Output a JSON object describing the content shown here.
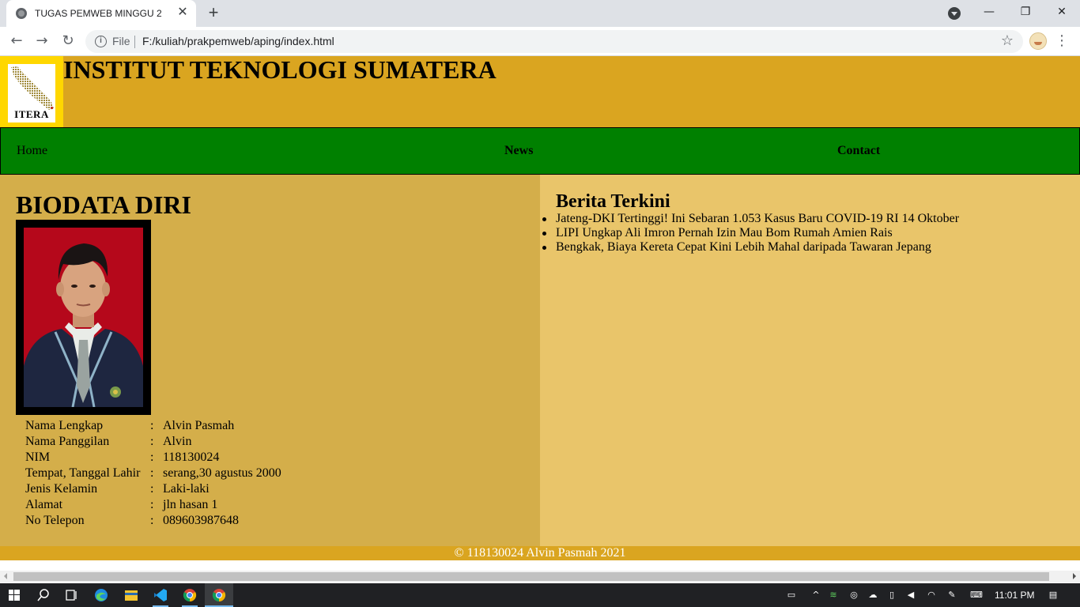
{
  "browser": {
    "tab_title": "TUGAS PEMWEB MINGGU 2",
    "tab_close": "✕",
    "new_tab": "+",
    "scheme_label": "File",
    "url": "F:/kuliah/prakpemweb/aping/index.html",
    "window_controls": {
      "minimize": "—",
      "restore": "❐",
      "close": "✕"
    },
    "nav": {
      "back": "←",
      "forward": "→",
      "reload": "↻"
    },
    "info": "i",
    "star": "☆",
    "menu": "⋮"
  },
  "site": {
    "logo_text": "ITERA",
    "title": "INSTITUT TEKNOLOGI SUMATERA",
    "nav": [
      "Home",
      "News",
      "Contact"
    ],
    "bio": {
      "heading": "BIODATA DIRI",
      "separator": ":",
      "rows": [
        {
          "label": "Nama Lengkap",
          "value": "Alvin Pasmah"
        },
        {
          "label": "Nama Panggilan",
          "value": "Alvin"
        },
        {
          "label": "NIM",
          "value": "118130024"
        },
        {
          "label": "Tempat, Tanggal Lahir",
          "value": "serang,30 agustus 2000"
        },
        {
          "label": "Jenis Kelamin",
          "value": "Laki-laki"
        },
        {
          "label": "Alamat",
          "value": "jln hasan 1"
        },
        {
          "label": "No Telepon",
          "value": "089603987648"
        }
      ]
    },
    "news": {
      "heading": "Berita Terkini",
      "items": [
        "Jateng-DKI Tertinggi! Ini Sebaran 1.053 Kasus Baru COVID-19 RI 14 Oktober",
        "LIPI Ungkap Ali Imron Pernah Izin Mau Bom Rumah Amien Rais",
        "Bengkak, Biaya Kereta Cepat Kini Lebih Mahal daripada Tawaran Jepang"
      ]
    },
    "footer": "© 118130024 Alvin Pasmah 2021"
  },
  "taskbar": {
    "clock": "11:01 PM"
  },
  "colors": {
    "header": "#daa520",
    "logo_bg": "#ffd700",
    "nav": "#008000",
    "left_column": "#d4ae4a",
    "right_column": "#e9c56a",
    "photo_bg": "#b5081b"
  }
}
